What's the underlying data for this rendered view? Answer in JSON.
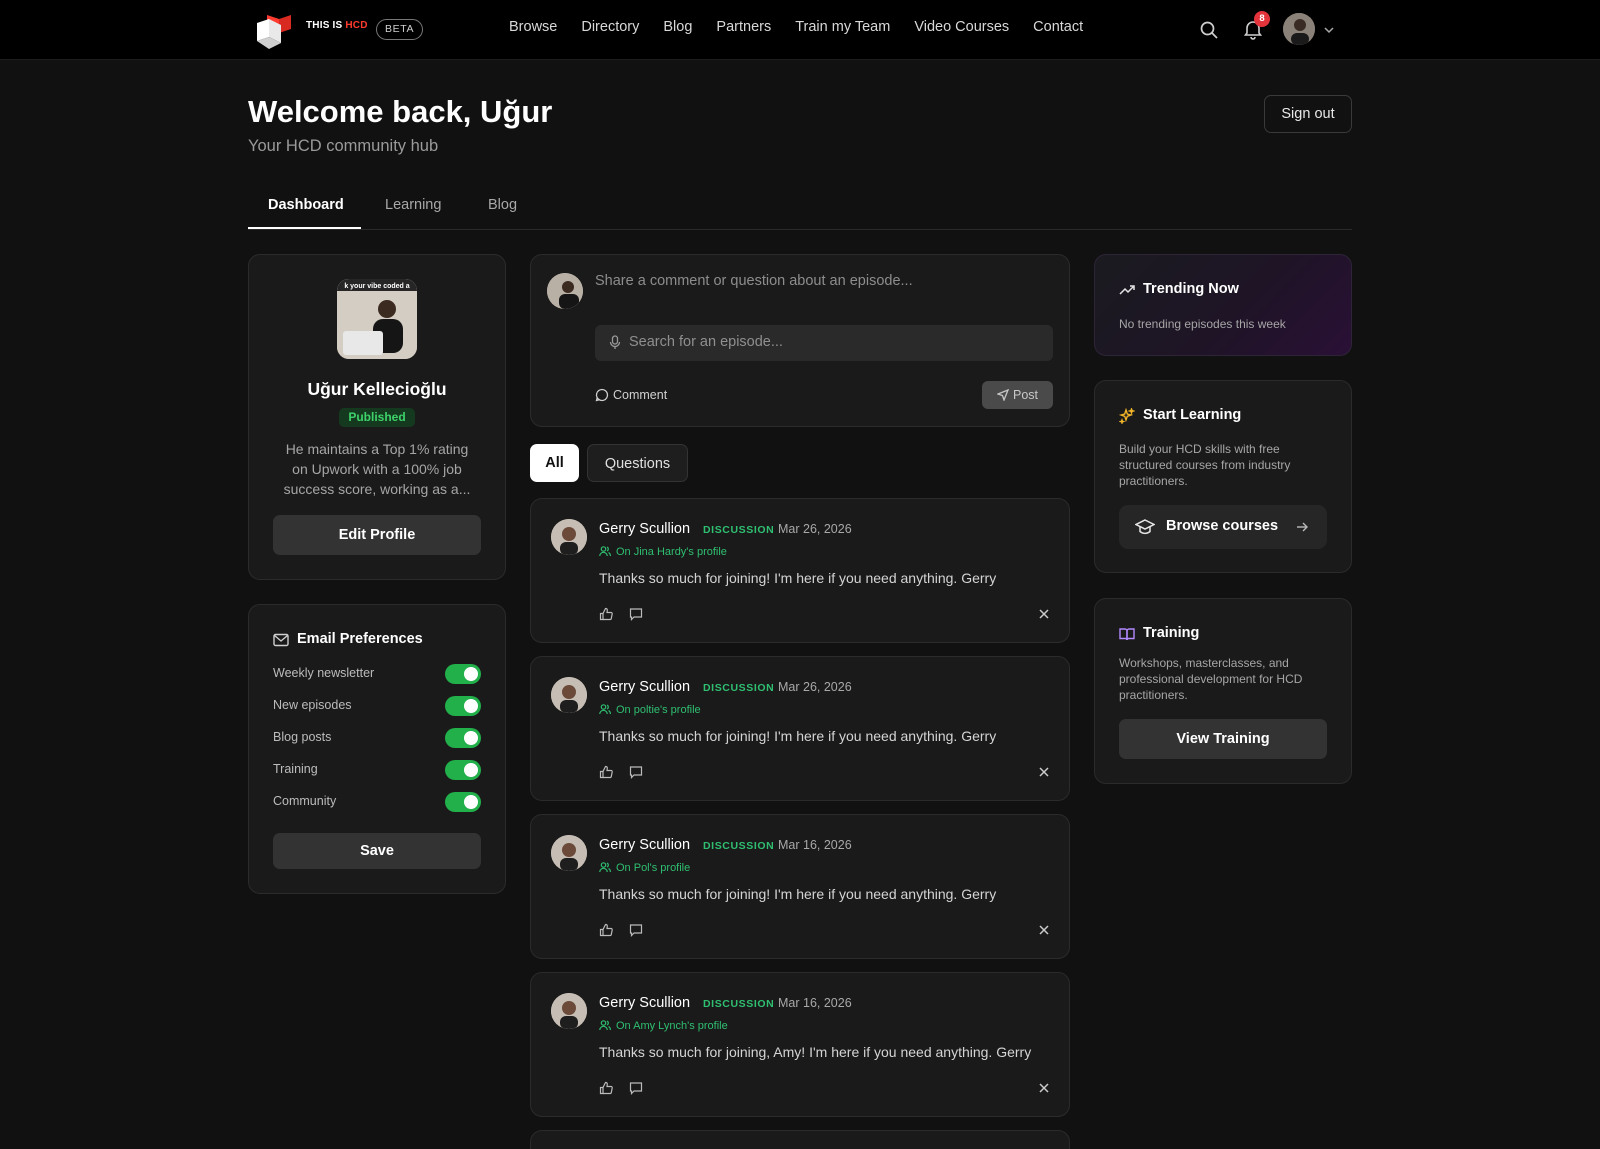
{
  "brand": {
    "name_prefix": "THIS IS",
    "name_accent": "HCD",
    "beta": "BETA"
  },
  "nav": {
    "items": [
      "Browse",
      "Directory",
      "Blog",
      "Partners",
      "Train my Team",
      "Video Courses",
      "Contact"
    ],
    "notification_count": "8"
  },
  "header": {
    "welcome": "Welcome back, Uğur",
    "subtitle": "Your HCD community hub",
    "sign_out": "Sign out"
  },
  "tabs": [
    "Dashboard",
    "Learning",
    "Blog"
  ],
  "profile": {
    "photo_caption": "k your vibe coded a",
    "name": "Uğur Kellecioğlu",
    "status": "Published",
    "bio": "He maintains a Top 1% rating on Upwork with a 100% job success score, working as a...",
    "edit_button": "Edit Profile"
  },
  "email_prefs": {
    "title": "Email Preferences",
    "items": [
      {
        "label": "Weekly newsletter",
        "on": true
      },
      {
        "label": "New episodes",
        "on": true
      },
      {
        "label": "Blog posts",
        "on": true
      },
      {
        "label": "Training",
        "on": true
      },
      {
        "label": "Community",
        "on": true
      }
    ],
    "save": "Save"
  },
  "composer": {
    "placeholder": "Share a comment or question about an episode...",
    "episode_search_placeholder": "Search for an episode...",
    "comment_label": "Comment",
    "post_label": "Post"
  },
  "filters": [
    "All",
    "Questions"
  ],
  "posts": [
    {
      "author": "Gerry Scullion",
      "tag": "DISCUSSION",
      "date": "Mar 26, 2026",
      "context": "On Jina Hardy's profile",
      "body": "Thanks so much for joining! I'm here if you need anything. Gerry"
    },
    {
      "author": "Gerry Scullion",
      "tag": "DISCUSSION",
      "date": "Mar 26, 2026",
      "context": "On poltie's profile",
      "body": "Thanks so much for joining! I'm here if you need anything. Gerry"
    },
    {
      "author": "Gerry Scullion",
      "tag": "DISCUSSION",
      "date": "Mar 16, 2026",
      "context": "On Pol's profile",
      "body": "Thanks so much for joining! I'm here if you need anything. Gerry"
    },
    {
      "author": "Gerry Scullion",
      "tag": "DISCUSSION",
      "date": "Mar 16, 2026",
      "context": "On Amy Lynch's profile",
      "body": "Thanks so much for joining, Amy! I'm here if you need anything. Gerry"
    }
  ],
  "trending": {
    "title": "Trending Now",
    "text": "No trending episodes this week"
  },
  "start_learning": {
    "title": "Start Learning",
    "text": "Build your HCD skills with free structured courses from industry practitioners.",
    "button": "Browse courses"
  },
  "training": {
    "title": "Training",
    "text": "Workshops, masterclasses, and professional development for HCD practitioners.",
    "button": "View Training"
  },
  "colors": {
    "accent_green": "#2fbf71",
    "toggle_green": "#22b04a",
    "brand_red": "#ff3b30",
    "badge_red": "#e5333c"
  }
}
